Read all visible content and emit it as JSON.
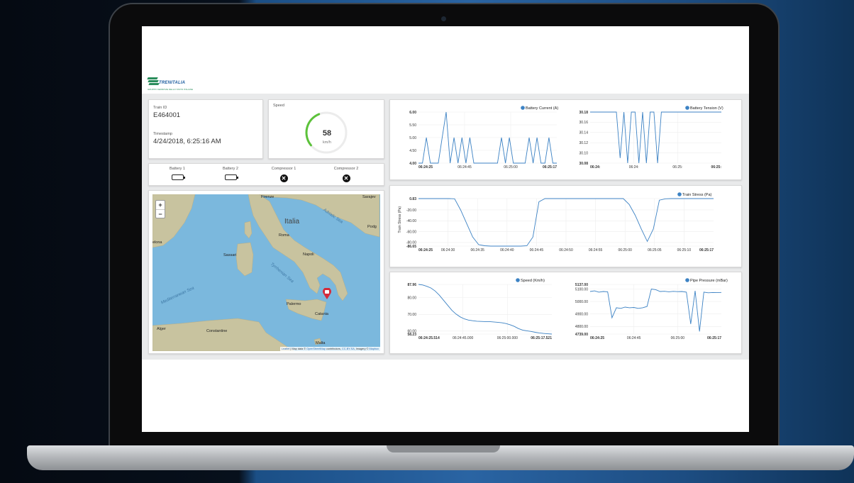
{
  "brand": {
    "logo_text": "TRENITALIA",
    "logo_subtext": "GRUPPO FERROVIE DELLO STATO ITALIANE"
  },
  "train": {
    "id_label": "Train ID",
    "id_value": "E464001",
    "ts_label": "Timestamp",
    "ts_value": "4/24/2018, 6:25:16 AM"
  },
  "speed_widget": {
    "label": "Speed",
    "value": "58",
    "unit": "km/h",
    "gauge_fraction": 0.3,
    "gauge_color": "#5cc23a"
  },
  "status": {
    "items": [
      {
        "label": "Battery 1",
        "icon": "battery-icon"
      },
      {
        "label": "Battery 2",
        "icon": "battery-icon"
      },
      {
        "label": "Compressor 1",
        "icon": "x-circle-icon"
      },
      {
        "label": "Compressor 2",
        "icon": "x-circle-icon"
      }
    ]
  },
  "map": {
    "zoom_in": "+",
    "zoom_out": "−",
    "places": [
      "Italia",
      "Roma",
      "Napoli",
      "Sassari",
      "Palermo",
      "Catania",
      "Alger",
      "Constantine",
      "Malta",
      "Firenze",
      "Sarajev",
      "Podg",
      "elona"
    ],
    "seas": [
      "Adriatic Sea",
      "Tyrrhenian Sea",
      "Mediterranean Sea"
    ],
    "attribution": {
      "leaflet": "Leaflet",
      "sep1": " | Map data © ",
      "osm": "OpenStreetMap",
      "mid": " contributors, ",
      "cc": "CC-BY-SA",
      "sep2": ", Imagery © ",
      "mapbox": "Mapbox"
    },
    "marker_icon": "train-marker-icon",
    "land_color": "#c9c4a4",
    "sea_color": "#7bb8dd"
  },
  "chart_data": [
    {
      "type": "line",
      "title": "",
      "series": [
        {
          "name": "Battery Current (A)"
        }
      ],
      "x": [
        "06:24:25",
        "06:24:45",
        "06:25:00",
        "06:25:17"
      ],
      "y_ticks": [
        "6.00",
        "5.50",
        "5.00",
        "4.50",
        "4.00"
      ],
      "ylim": [
        4.0,
        6.0
      ],
      "values": [
        4,
        4,
        5,
        4,
        4,
        4,
        5,
        6,
        4,
        5,
        4,
        5,
        4,
        5,
        4,
        4,
        4,
        4,
        4,
        4,
        4,
        5,
        4,
        5,
        4,
        4,
        4,
        4,
        5,
        4,
        5,
        4,
        4,
        5,
        4,
        4
      ],
      "color": "#3c82c4"
    },
    {
      "type": "line",
      "title": "",
      "series": [
        {
          "name": "Battery Tension (V)"
        }
      ],
      "x": [
        "06:24:",
        "06:24:",
        "06:25:",
        "06:25:"
      ],
      "y_ticks": [
        "30.18",
        "30.16",
        "30.14",
        "30.12",
        "30.10",
        "30.08"
      ],
      "ylim": [
        30.08,
        30.18
      ],
      "values": [
        30.18,
        30.18,
        30.18,
        30.18,
        30.18,
        30.18,
        30.18,
        30.18,
        30.09,
        30.18,
        30.08,
        30.18,
        30.18,
        30.08,
        30.18,
        30.08,
        30.18,
        30.18,
        30.08,
        30.18,
        30.18,
        30.18,
        30.18,
        30.18,
        30.18,
        30.18,
        30.18,
        30.18,
        30.18,
        30.18,
        30.18,
        30.18,
        30.18,
        30.18,
        30.18,
        30.18
      ],
      "color": "#3c82c4"
    },
    {
      "type": "line",
      "title": "",
      "ylabel": "Train Stress (Pa)",
      "series": [
        {
          "name": "Train Stress (Pa)"
        }
      ],
      "x": [
        "06:24:25",
        "06:24:30",
        "06:24:35",
        "06:24:40",
        "06:24:45",
        "06:24:50",
        "06:24:55",
        "06:25:00",
        "06:25:05",
        "06:25:10",
        "06:25:17"
      ],
      "y_ticks": [
        "0.83",
        "-20.00",
        "-40.00",
        "-60.00",
        "-80.00",
        "-86.65"
      ],
      "ylim": [
        -86.65,
        0.83
      ],
      "values": [
        0.83,
        0.83,
        0.83,
        0.83,
        0.83,
        0.83,
        0.5,
        -20,
        -45,
        -70,
        -84,
        -86,
        -86.65,
        -86.65,
        -86.65,
        -86.65,
        -86.65,
        -86.65,
        -86,
        -70,
        -5,
        0.83,
        0.83,
        0.83,
        0.83,
        0.83,
        0.83,
        0.83,
        0.83,
        0.83,
        0.83,
        0.83,
        0.83,
        0.83,
        0.83,
        -10,
        -30,
        -55,
        -78,
        -55,
        -2,
        0.5,
        0.83,
        0.83,
        0.83,
        0.83,
        0.83,
        0.83,
        0.83,
        0.83
      ],
      "color": "#3c82c4"
    },
    {
      "type": "line",
      "title": "",
      "series": [
        {
          "name": "Speed (Km/h)"
        }
      ],
      "x": [
        "06:24:25.514",
        "06:24:45.000",
        "06:25:00.000",
        "06:25:17.521"
      ],
      "y_ticks": [
        "87.96",
        "80.00",
        "70.00",
        "60.00",
        "58.23"
      ],
      "ylim": [
        58.23,
        87.96
      ],
      "values": [
        87.96,
        87.6,
        86.8,
        85.8,
        84,
        81.5,
        78.5,
        75.5,
        72.5,
        70.2,
        68.5,
        67.3,
        66.6,
        66.2,
        65.9,
        65.8,
        65.7,
        65.7,
        65.5,
        65.3,
        65.0,
        64.5,
        63.8,
        62.8,
        61.5,
        60.6,
        60.2,
        59.8,
        59.3,
        58.9,
        58.6,
        58.4,
        58.23
      ],
      "color": "#3c82c4"
    },
    {
      "type": "line",
      "title": "",
      "series": [
        {
          "name": "Pipe Pressure (mBar)"
        }
      ],
      "x": [
        "06:24:25",
        "06:24:45",
        "06:25:00",
        "06:25:17"
      ],
      "y_ticks": [
        "5137.00",
        "5100.00",
        "5000.00",
        "4900.00",
        "4800.00",
        "4739.00"
      ],
      "ylim": [
        4739.0,
        5137.0
      ],
      "values": [
        5080,
        5085,
        5075,
        5080,
        5078,
        4870,
        4950,
        4945,
        4955,
        4950,
        4952,
        4945,
        4950,
        4960,
        5100,
        5095,
        5080,
        5082,
        5078,
        5081,
        5079,
        5080,
        5075,
        4820,
        5085,
        4760,
        5075,
        5070,
        5072,
        5071,
        5073
      ],
      "color": "#3c82c4"
    }
  ]
}
